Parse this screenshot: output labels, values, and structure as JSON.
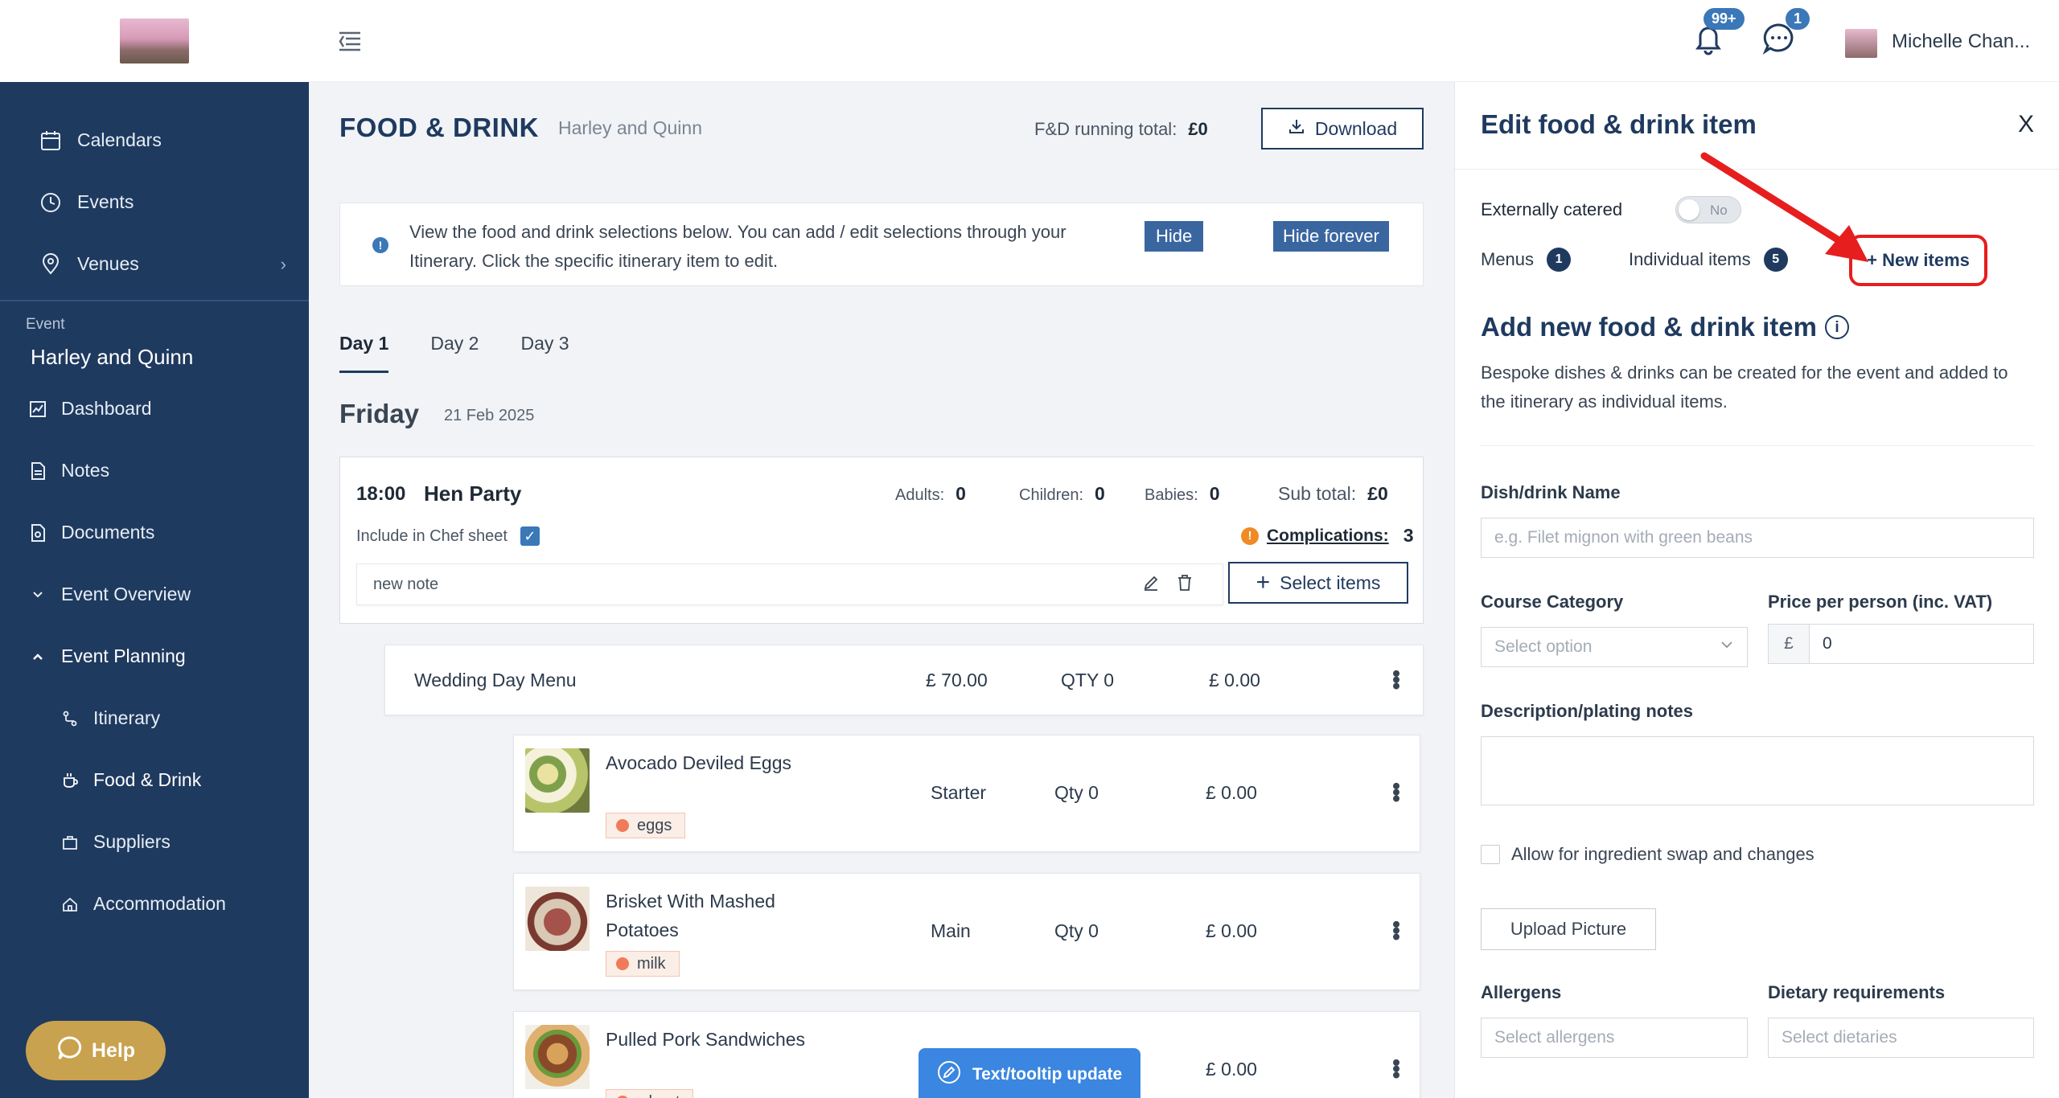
{
  "topbar": {
    "notif_count": "99+",
    "chat_count": "1",
    "user_name": "Michelle Chan..."
  },
  "sidebar": {
    "nav": [
      {
        "label": "Calendars",
        "icon": "calendar-icon"
      },
      {
        "label": "Events",
        "icon": "clock-icon"
      },
      {
        "label": "Venues",
        "icon": "location-pin-icon"
      }
    ],
    "event_label": "Event",
    "event_name": "Harley and Quinn",
    "items": [
      {
        "label": "Dashboard"
      },
      {
        "label": "Notes"
      },
      {
        "label": "Documents"
      },
      {
        "label": "Event Overview"
      },
      {
        "label": "Event Planning"
      }
    ],
    "planning_items": [
      {
        "label": "Itinerary"
      },
      {
        "label": "Food & Drink"
      },
      {
        "label": "Suppliers"
      },
      {
        "label": "Accommodation"
      }
    ],
    "help_label": "Help"
  },
  "main": {
    "title": "FOOD & DRINK",
    "subtitle": "Harley and Quinn",
    "running_total_label": "F&D running total:",
    "running_total_value": "£0",
    "download_label": "Download",
    "info_text": "View the food and drink selections below. You can add / edit selections through your Itinerary. Click the specific itinerary item to edit.",
    "hide_label": "Hide",
    "hide_forever_label": "Hide forever",
    "tabs": [
      {
        "label": "Day 1",
        "active": true
      },
      {
        "label": "Day 2",
        "active": false
      },
      {
        "label": "Day 3",
        "active": false
      }
    ],
    "day_name": "Friday",
    "day_date": "21 Feb 2025",
    "event": {
      "time": "18:00",
      "name": "Hen Party",
      "adults_label": "Adults:",
      "adults": "0",
      "children_label": "Children:",
      "children": "0",
      "babies_label": "Babies:",
      "babies": "0",
      "subtotal_label": "Sub total:",
      "subtotal": "£0",
      "chef_label": "Include in Chef sheet",
      "complications_label": "Complications:",
      "complications": "3",
      "note": "new note",
      "select_items_label": "Select items"
    },
    "menu": {
      "name": "Wedding Day Menu",
      "price": "£ 70.00",
      "qty": "QTY 0",
      "total": "£ 0.00"
    },
    "dishes": [
      {
        "name": "Avocado Deviled Eggs",
        "allergen": "eggs",
        "course": "Starter",
        "qty": "Qty 0",
        "total": "£ 0.00"
      },
      {
        "name": "Brisket With Mashed Potatoes",
        "allergen": "milk",
        "course": "Main",
        "qty": "Qty 0",
        "total": "£ 0.00"
      },
      {
        "name": "Pulled Pork Sandwiches",
        "allergen": "wheat",
        "course": "",
        "qty": "",
        "total": "£ 0.00"
      }
    ],
    "toast_label": "Text/tooltip update"
  },
  "panel": {
    "title": "Edit food & drink item",
    "close": "X",
    "externally_catered_label": "Externally catered",
    "toggle_text": "No",
    "menus_label": "Menus",
    "menus_count": "1",
    "individual_label": "Individual items",
    "individual_count": "5",
    "new_items_label": "+ New items",
    "add_title": "Add new food & drink item",
    "add_desc": "Bespoke dishes & drinks can be created for the event and added to the itinerary as individual items.",
    "dish_name_label": "Dish/drink Name",
    "dish_name_placeholder": "e.g. Filet mignon with green beans",
    "course_label": "Course Category",
    "course_placeholder": "Select option",
    "price_label": "Price per person (inc. VAT)",
    "price_prefix": "£",
    "price_value": "0",
    "desc_label": "Description/plating notes",
    "swap_label": "Allow for ingredient swap and changes",
    "upload_label": "Upload Picture",
    "allergens_label": "Allergens",
    "allergens_placeholder": "Select allergens",
    "dietary_label": "Dietary requirements",
    "dietary_placeholder": "Select dietaries"
  },
  "colors": {
    "sidebar": "#1f3a5f",
    "accent": "#3a78b8",
    "highlight": "#e61e1e",
    "help": "#c9a24f"
  }
}
